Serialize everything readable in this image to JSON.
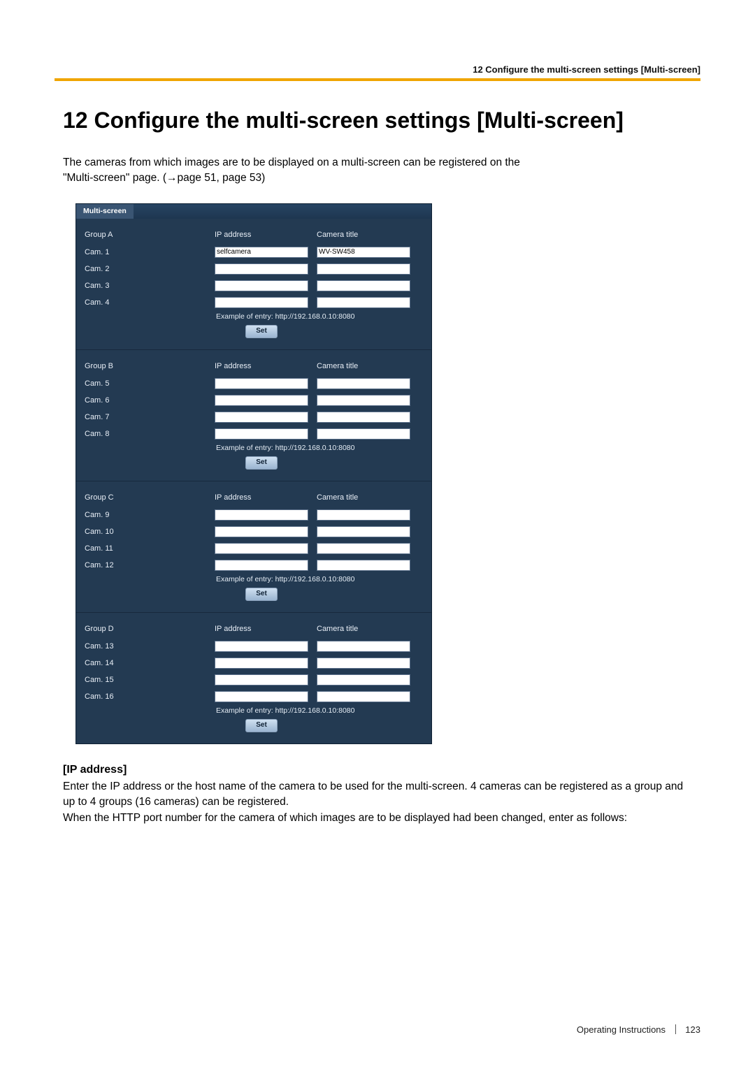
{
  "running_header": "12 Configure the multi-screen settings [Multi-screen]",
  "chapter_title": "12   Configure the multi-screen settings [Multi-screen]",
  "intro_line1": "The cameras from which images are to be displayed on a multi-screen can be registered on the",
  "intro_line2_before": "\"Multi-screen\" page. (",
  "intro_line2_ref": "→page 51, page 53",
  "intro_line2_after": ")",
  "screenshot": {
    "tab_label": "Multi-screen",
    "col_ip": "IP address",
    "col_title": "Camera title",
    "example_text": "Example of entry: http://192.168.0.10:8080",
    "set_label": "Set",
    "groups": [
      {
        "name": "Group A",
        "cams": [
          {
            "label": "Cam. 1",
            "ip": "selfcamera",
            "title": "WV-SW458"
          },
          {
            "label": "Cam. 2",
            "ip": "",
            "title": ""
          },
          {
            "label": "Cam. 3",
            "ip": "",
            "title": ""
          },
          {
            "label": "Cam. 4",
            "ip": "",
            "title": ""
          }
        ]
      },
      {
        "name": "Group B",
        "cams": [
          {
            "label": "Cam. 5",
            "ip": "",
            "title": ""
          },
          {
            "label": "Cam. 6",
            "ip": "",
            "title": ""
          },
          {
            "label": "Cam. 7",
            "ip": "",
            "title": ""
          },
          {
            "label": "Cam. 8",
            "ip": "",
            "title": ""
          }
        ]
      },
      {
        "name": "Group C",
        "cams": [
          {
            "label": "Cam. 9",
            "ip": "",
            "title": ""
          },
          {
            "label": "Cam. 10",
            "ip": "",
            "title": ""
          },
          {
            "label": "Cam. 11",
            "ip": "",
            "title": ""
          },
          {
            "label": "Cam. 12",
            "ip": "",
            "title": ""
          }
        ]
      },
      {
        "name": "Group D",
        "cams": [
          {
            "label": "Cam. 13",
            "ip": "",
            "title": ""
          },
          {
            "label": "Cam. 14",
            "ip": "",
            "title": ""
          },
          {
            "label": "Cam. 15",
            "ip": "",
            "title": ""
          },
          {
            "label": "Cam. 16",
            "ip": "",
            "title": ""
          }
        ]
      }
    ]
  },
  "field_heading": "[IP address]",
  "body_p1": "Enter the IP address or the host name of the camera to be used for the multi-screen. 4 cameras can be registered as a group and up to 4 groups (16 cameras) can be registered.",
  "body_p2": "When the HTTP port number for the camera of which images are to be displayed had been changed, enter as follows:",
  "footer_label": "Operating Instructions",
  "footer_page": "123"
}
